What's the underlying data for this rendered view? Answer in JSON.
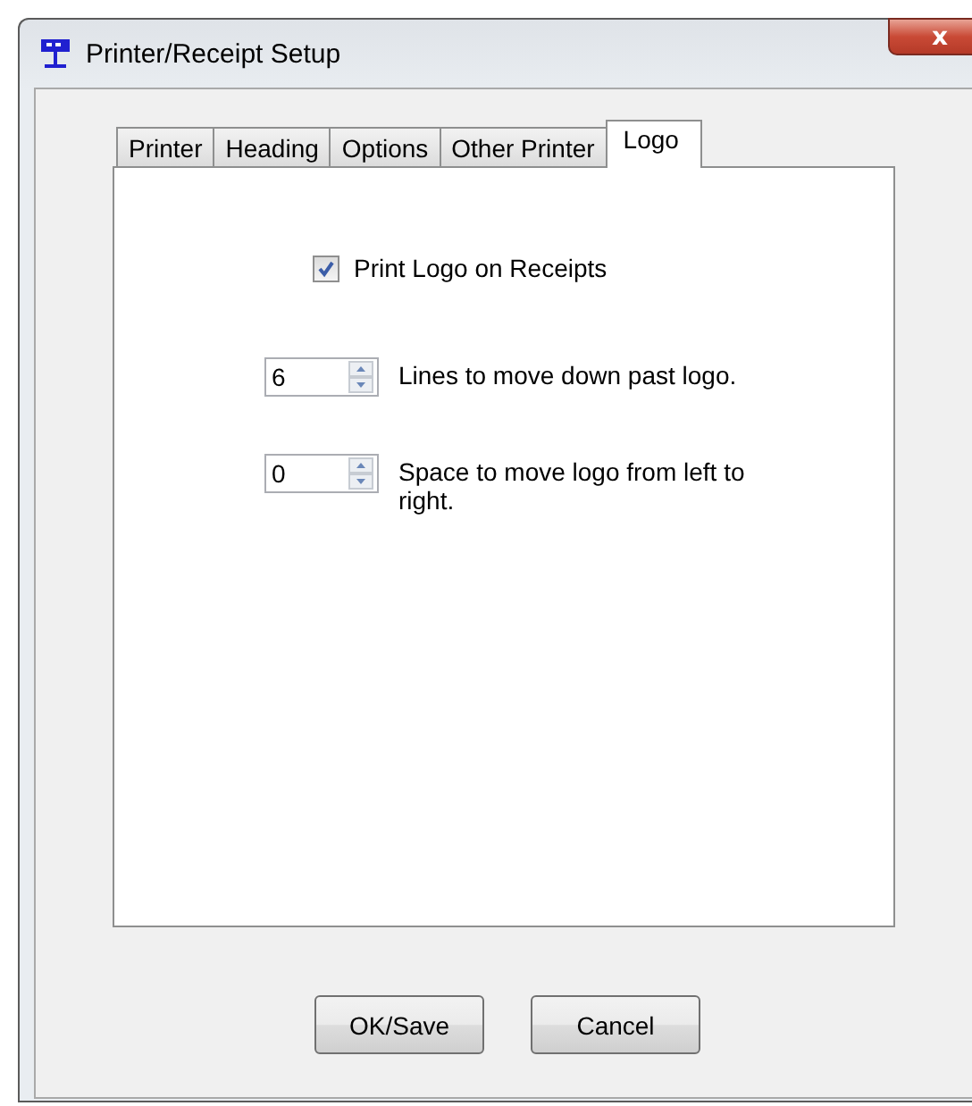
{
  "window": {
    "title": "Printer/Receipt Setup",
    "close": "x"
  },
  "tabs": [
    {
      "label": "Printer",
      "selected": false
    },
    {
      "label": "Heading",
      "selected": false
    },
    {
      "label": "Options",
      "selected": false
    },
    {
      "label": "Other Printer",
      "selected": false
    },
    {
      "label": "Logo",
      "selected": true
    }
  ],
  "print_logo": {
    "label": "Print Logo on Receipts",
    "checked": true
  },
  "spinners": [
    {
      "value": "6",
      "label": "Lines to move down past logo."
    },
    {
      "value": "0",
      "label": "Space to move logo from left to right."
    }
  ],
  "buttons": [
    "OK/Save",
    "Cancel"
  ]
}
